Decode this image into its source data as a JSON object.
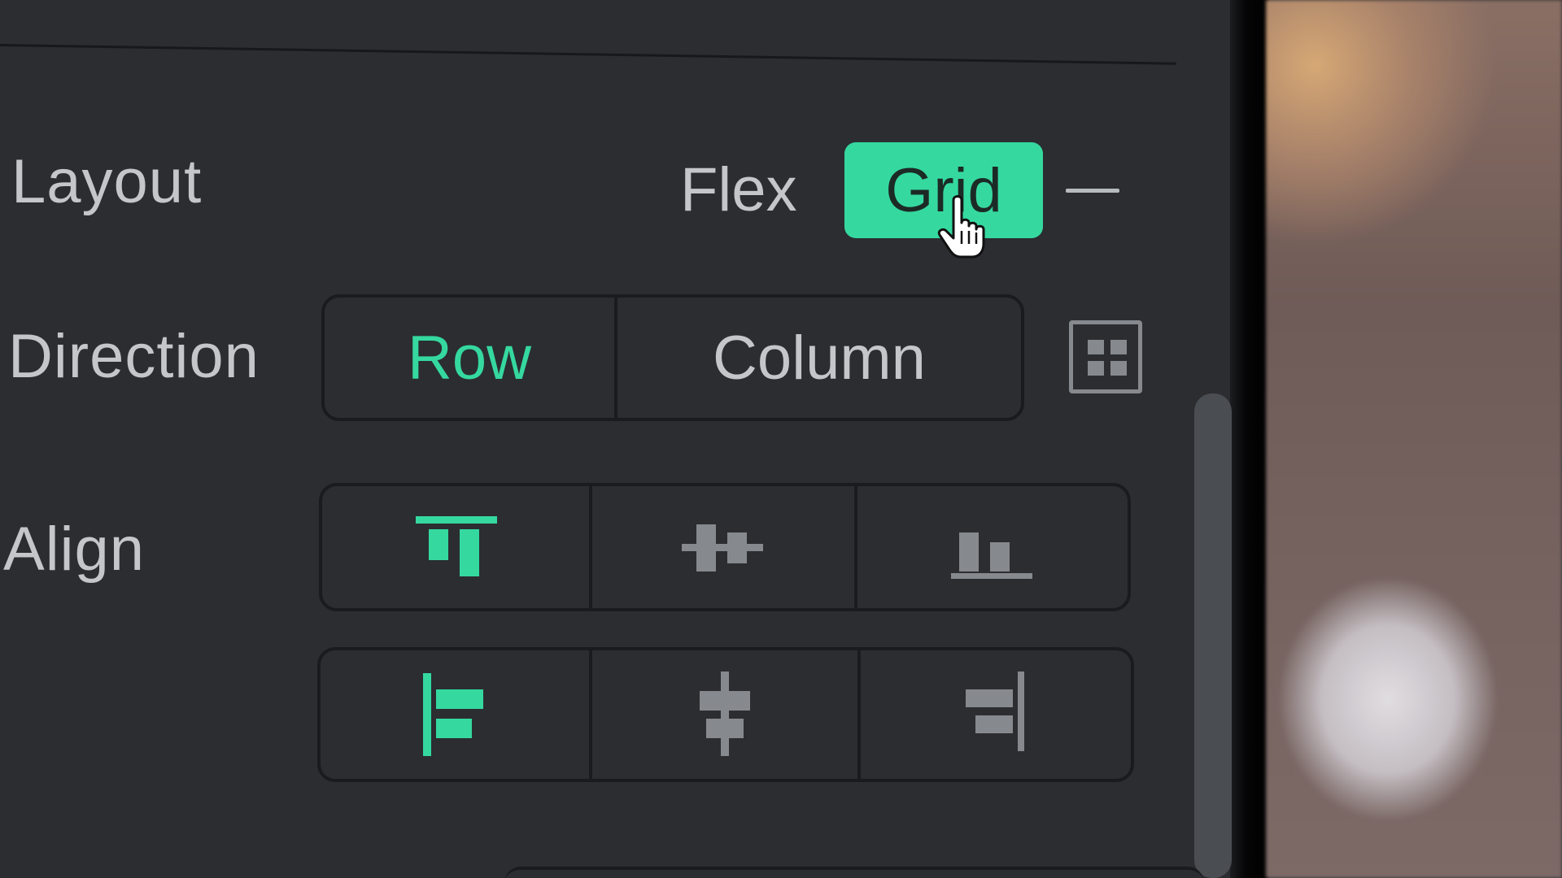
{
  "colors": {
    "accent": "#35d9a0",
    "panel": "#2b2d31",
    "text": "#c4c6c9",
    "icon_inactive": "#86898d"
  },
  "layout_row": {
    "label": "Layout",
    "options": [
      "Flex",
      "Grid"
    ],
    "selected": "Grid",
    "collapse_icon": "minus-icon"
  },
  "direction_row": {
    "label": "Direction",
    "options": [
      "Row",
      "Column"
    ],
    "selected": "Row",
    "extra_icon": "grid-icon"
  },
  "align_row": {
    "label": "Align",
    "vertical_options": [
      {
        "icon": "align-top-icon",
        "selected": true
      },
      {
        "icon": "align-center-vertical-icon",
        "selected": false
      },
      {
        "icon": "align-bottom-icon",
        "selected": false
      }
    ],
    "horizontal_options": [
      {
        "icon": "align-left-icon",
        "selected": true
      },
      {
        "icon": "align-center-horizontal-icon",
        "selected": false
      },
      {
        "icon": "align-right-icon",
        "selected": false
      }
    ]
  },
  "cursor": "hand-pointer-icon"
}
